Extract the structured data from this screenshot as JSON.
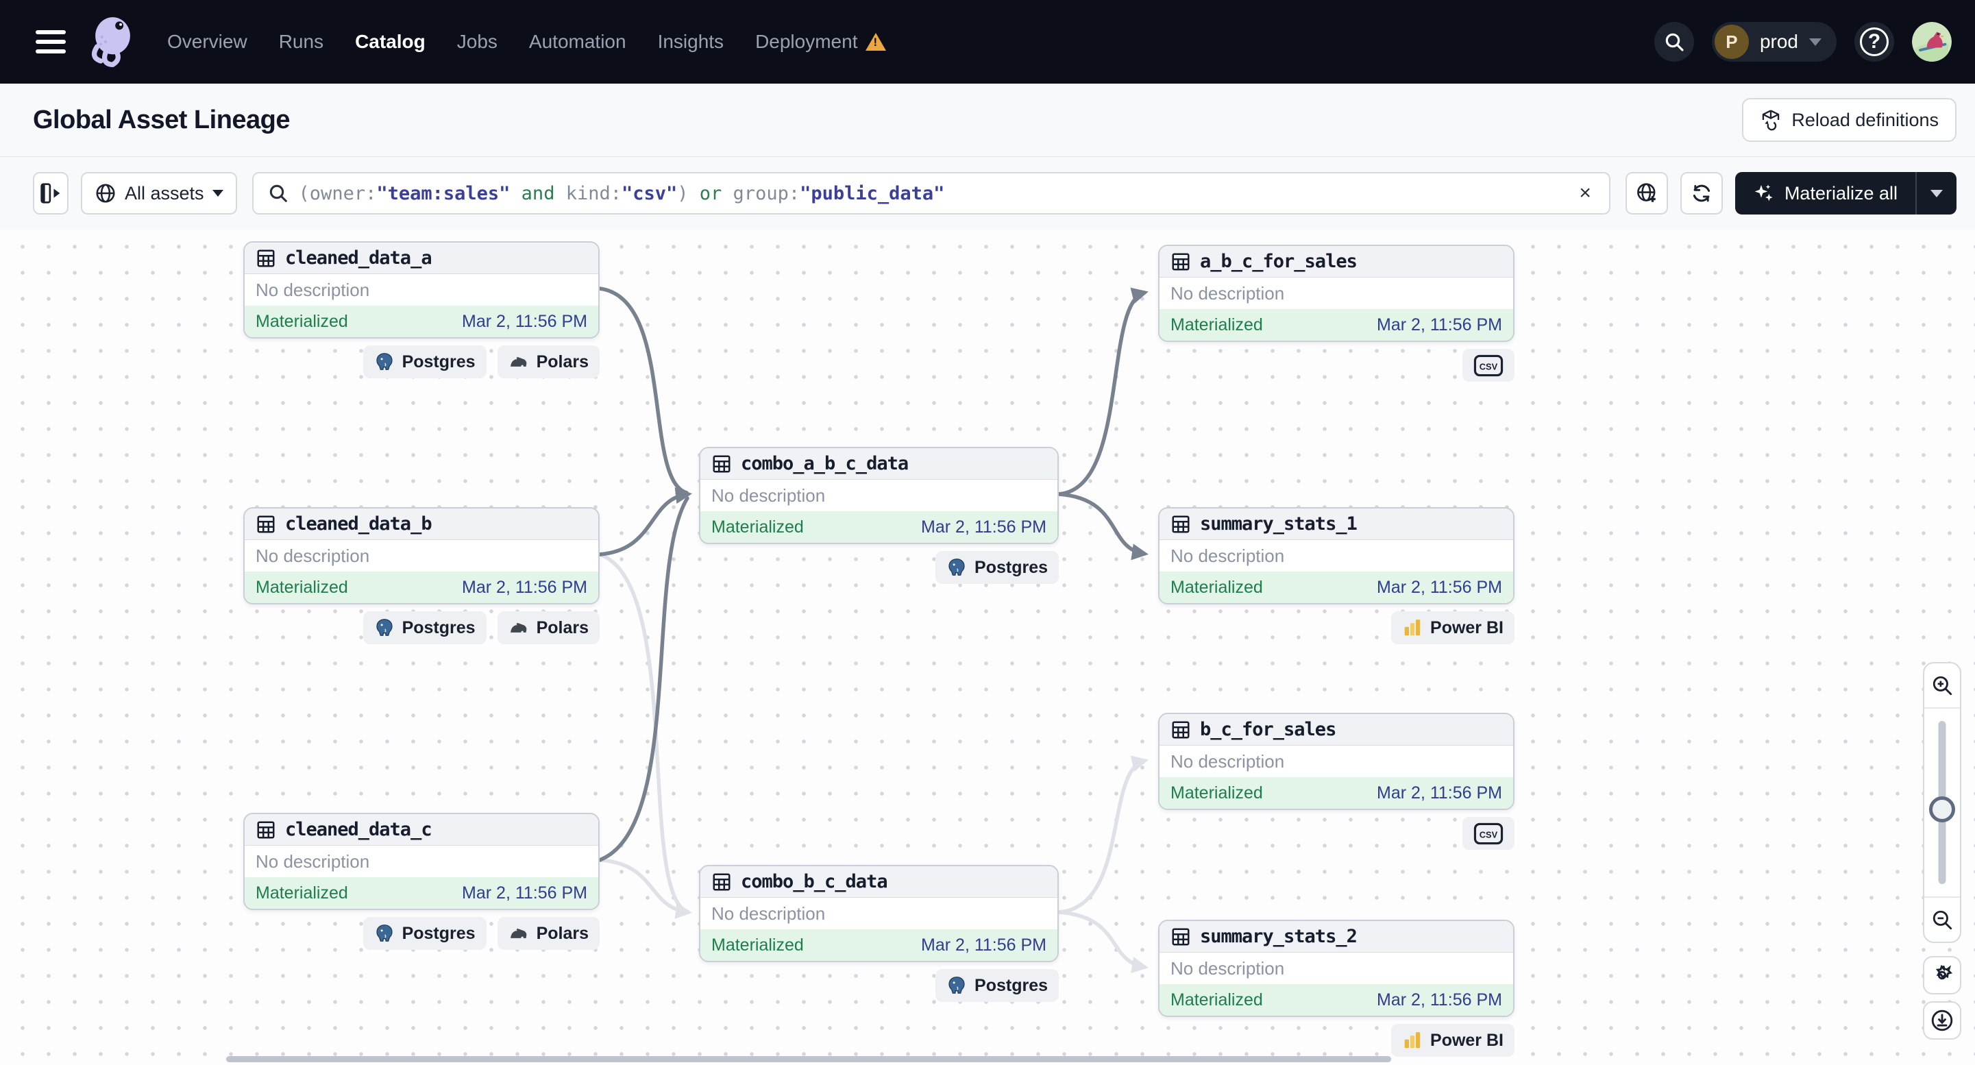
{
  "nav": {
    "items": [
      {
        "id": "overview",
        "label": "Overview",
        "active": false,
        "warning": false
      },
      {
        "id": "runs",
        "label": "Runs",
        "active": false,
        "warning": false
      },
      {
        "id": "catalog",
        "label": "Catalog",
        "active": true,
        "warning": false
      },
      {
        "id": "jobs",
        "label": "Jobs",
        "active": false,
        "warning": false
      },
      {
        "id": "automation",
        "label": "Automation",
        "active": false,
        "warning": false
      },
      {
        "id": "insights",
        "label": "Insights",
        "active": false,
        "warning": false
      },
      {
        "id": "deployment",
        "label": "Deployment",
        "active": false,
        "warning": true
      }
    ],
    "workspace": {
      "initial": "P",
      "name": "prod"
    }
  },
  "header": {
    "title": "Global Asset Lineage",
    "reload_label": "Reload definitions"
  },
  "toolbar": {
    "asset_filter_label": "All assets",
    "search_query_segments": [
      {
        "text": "(owner:",
        "type": "plain"
      },
      {
        "text": "\"team:sales\"",
        "type": "value"
      },
      {
        "text": " and ",
        "type": "operator"
      },
      {
        "text": "kind:",
        "type": "plain"
      },
      {
        "text": "\"csv\"",
        "type": "value"
      },
      {
        "text": ") ",
        "type": "plain"
      },
      {
        "text": "or",
        "type": "operator"
      },
      {
        "text": " group:",
        "type": "plain"
      },
      {
        "text": "\"public_data\"",
        "type": "value"
      }
    ],
    "clear_label": "×",
    "materialize_label": "Materialize all"
  },
  "graph": {
    "shared": {
      "description": "No description",
      "status": "Materialized",
      "timestamp": "Mar 2, 11:56 PM"
    },
    "nodes": [
      {
        "id": "cleaned_data_a",
        "name": "cleaned_data_a",
        "tags": [
          "postgres",
          "polars"
        ]
      },
      {
        "id": "cleaned_data_b",
        "name": "cleaned_data_b",
        "tags": [
          "postgres",
          "polars"
        ]
      },
      {
        "id": "cleaned_data_c",
        "name": "cleaned_data_c",
        "tags": [
          "postgres",
          "polars"
        ]
      },
      {
        "id": "combo_a_b_c_data",
        "name": "combo_a_b_c_data",
        "tags": [
          "postgres"
        ]
      },
      {
        "id": "combo_b_c_data",
        "name": "combo_b_c_data",
        "tags": [
          "postgres"
        ]
      },
      {
        "id": "a_b_c_for_sales",
        "name": "a_b_c_for_sales",
        "tags": [
          "csv"
        ]
      },
      {
        "id": "summary_stats_1",
        "name": "summary_stats_1",
        "tags": [
          "powerbi"
        ]
      },
      {
        "id": "b_c_for_sales",
        "name": "b_c_for_sales",
        "tags": [
          "csv"
        ]
      },
      {
        "id": "summary_stats_2",
        "name": "summary_stats_2",
        "tags": [
          "powerbi"
        ]
      }
    ],
    "edges": [
      {
        "from": "cleaned_data_a",
        "to": "combo_a_b_c_data",
        "highlighted": true
      },
      {
        "from": "cleaned_data_b",
        "to": "combo_a_b_c_data",
        "highlighted": true
      },
      {
        "from": "cleaned_data_c",
        "to": "combo_a_b_c_data",
        "highlighted": true
      },
      {
        "from": "cleaned_data_b",
        "to": "combo_b_c_data",
        "highlighted": false
      },
      {
        "from": "cleaned_data_c",
        "to": "combo_b_c_data",
        "highlighted": false
      },
      {
        "from": "combo_a_b_c_data",
        "to": "a_b_c_for_sales",
        "highlighted": true
      },
      {
        "from": "combo_a_b_c_data",
        "to": "summary_stats_1",
        "highlighted": true
      },
      {
        "from": "combo_b_c_data",
        "to": "b_c_for_sales",
        "highlighted": false
      },
      {
        "from": "combo_b_c_data",
        "to": "summary_stats_2",
        "highlighted": false
      }
    ]
  },
  "tag_labels": {
    "postgres": "Postgres",
    "polars": "Polars",
    "csv": "csv",
    "powerbi": "Power BI"
  },
  "colors": {
    "nav_background": "#0b0e18",
    "status_green": "#1e7e4b",
    "status_green_bg": "#e3f4e9",
    "timestamp_navy": "#303c8f",
    "query_value": "#3b3f97",
    "query_operator": "#2d7d51",
    "query_plain": "#828a99",
    "edge_highlighted": "#78828f",
    "edge_faded": "#dee2e8",
    "warning_orange": "#eda73f",
    "powerbi_yellow": "#e9b63c",
    "postgres_blue": "#3a6795"
  }
}
